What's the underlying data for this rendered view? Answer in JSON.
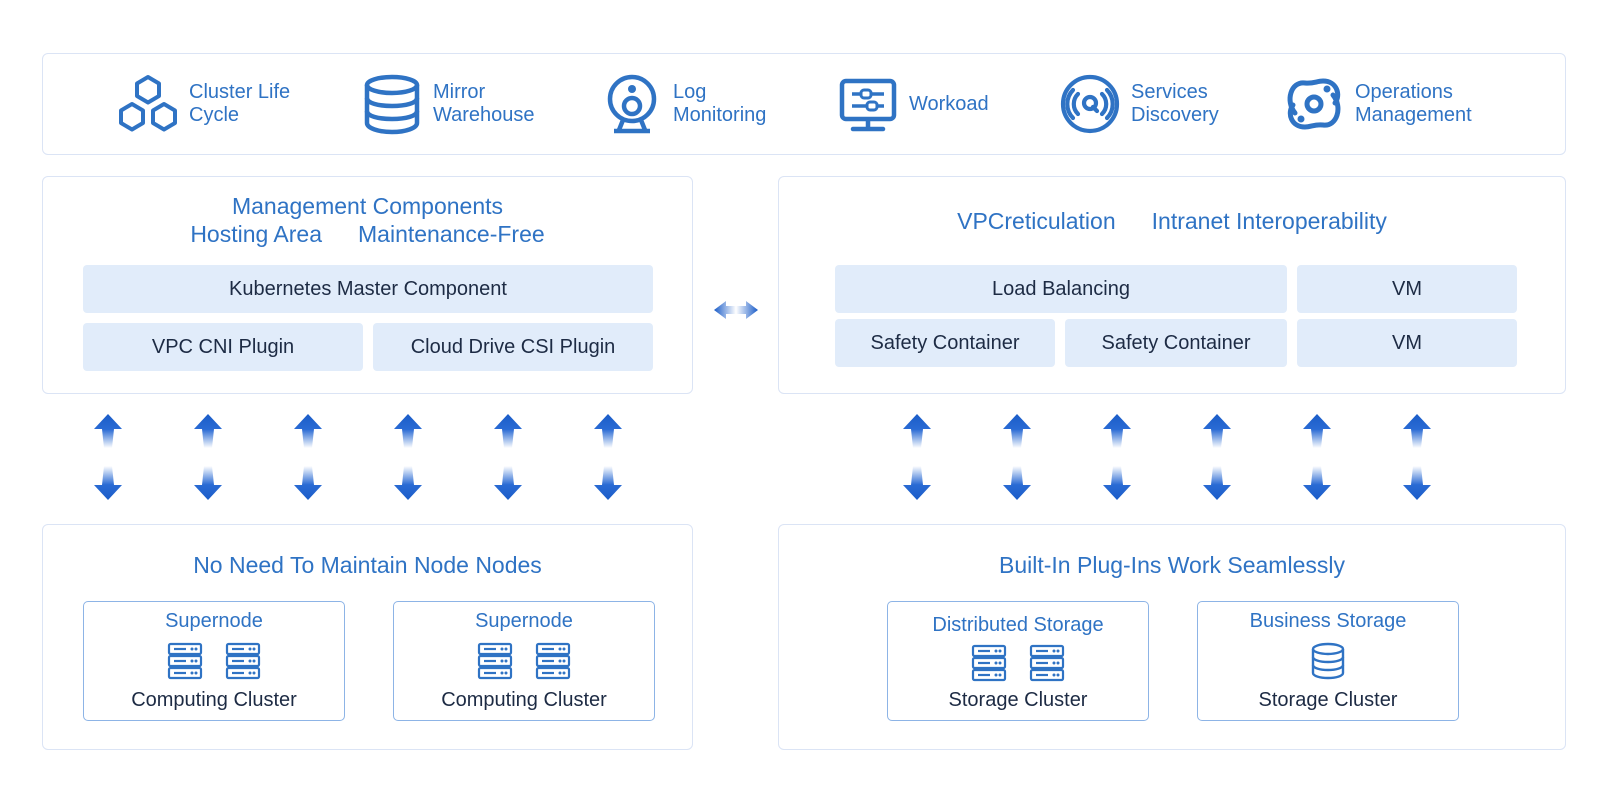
{
  "colors": {
    "accent": "#2f73c4",
    "chip_bg": "#e1ecfa",
    "border": "#dbe4f5",
    "card_border": "#8db4e6",
    "arrow": "#1a5cc8"
  },
  "features": [
    {
      "label": "Cluster Life\nCycle",
      "icon": "hexagons-icon"
    },
    {
      "label": "Mirror\nWarehouse",
      "icon": "database-icon"
    },
    {
      "label": "Log\nMonitoring",
      "icon": "webcam-icon"
    },
    {
      "label": "Workoad",
      "icon": "monitor-sliders-icon"
    },
    {
      "label": "Services\nDiscovery",
      "icon": "broadcast-icon"
    },
    {
      "label": "Operations\nManagement",
      "icon": "operations-icon"
    }
  ],
  "management": {
    "title_line1": "Management Components",
    "title_line2a": "Hosting Area",
    "title_line2b": "Maintenance-Free",
    "master": "Kubernetes Master Component",
    "cni": "VPC CNI Plugin",
    "csi": "Cloud Drive CSI Plugin"
  },
  "vpc": {
    "title_a": "VPCreticulation",
    "title_b": "Intranet Interoperability",
    "load_balancing": "Load Balancing",
    "vm1": "VM",
    "safety1": "Safety Container",
    "safety2": "Safety Container",
    "vm2": "VM"
  },
  "nodes": {
    "title": "No Need To Maintain Node Nodes",
    "cards": [
      {
        "title": "Supernode",
        "footer": "Computing Cluster"
      },
      {
        "title": "Supernode",
        "footer": "Computing Cluster"
      }
    ]
  },
  "plugins": {
    "title": "Built-In Plug-Ins Work Seamlessly",
    "cards": [
      {
        "title": "Distributed Storage",
        "footer": "Storage Cluster"
      },
      {
        "title": "Business Storage",
        "footer": "Storage Cluster"
      }
    ]
  }
}
